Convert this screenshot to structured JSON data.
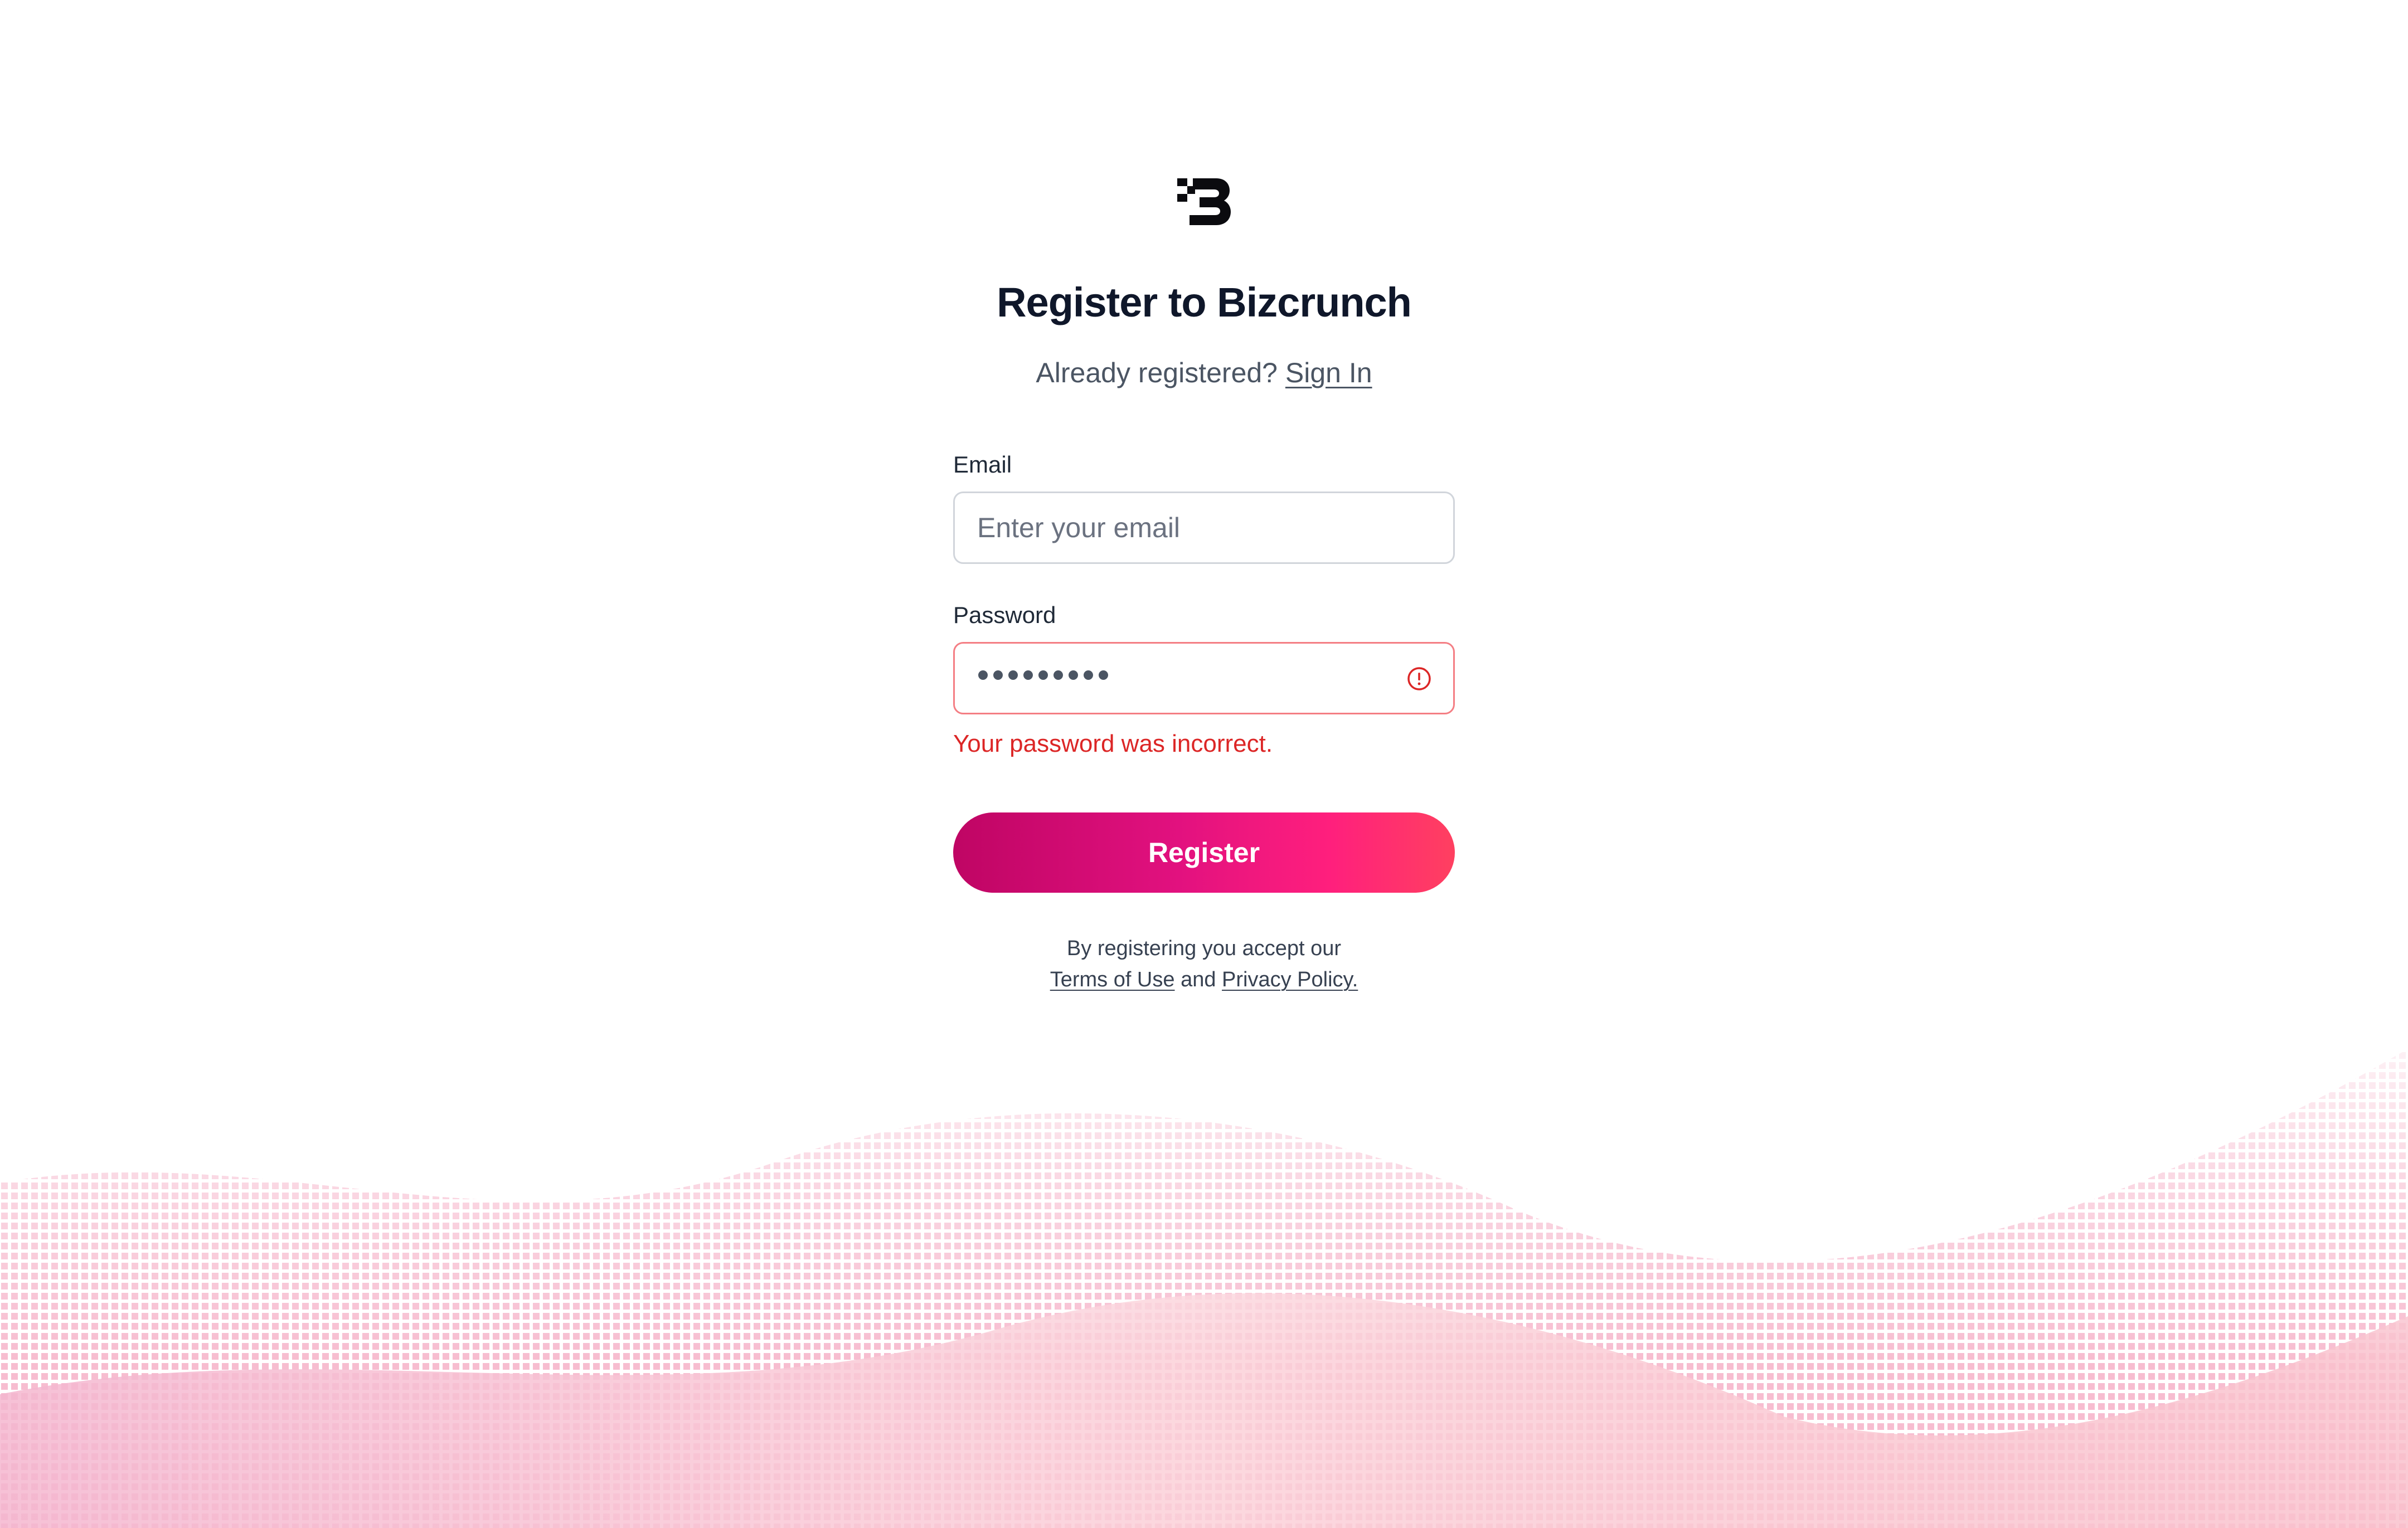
{
  "brand": {
    "logo_icon": "bizcrunch-b-logo",
    "accent_start": "#bf0564",
    "accent_end": "#ff4060",
    "error_color": "#dc2626"
  },
  "header": {
    "title": "Register to Bizcrunch",
    "already_registered": "Already registered?",
    "sign_in_link": "Sign In"
  },
  "form": {
    "email": {
      "label": "Email",
      "placeholder": "Enter your email",
      "value": ""
    },
    "password": {
      "label": "Password",
      "masked_length": 9,
      "error_icon": "alert-circle-icon",
      "error_message": "Your password was incorrect."
    },
    "submit_label": "Register"
  },
  "legal": {
    "prefix": "By registering you accept our",
    "terms_link": "Terms of Use",
    "conjunction": "and",
    "privacy_link": "Privacy Policy."
  }
}
